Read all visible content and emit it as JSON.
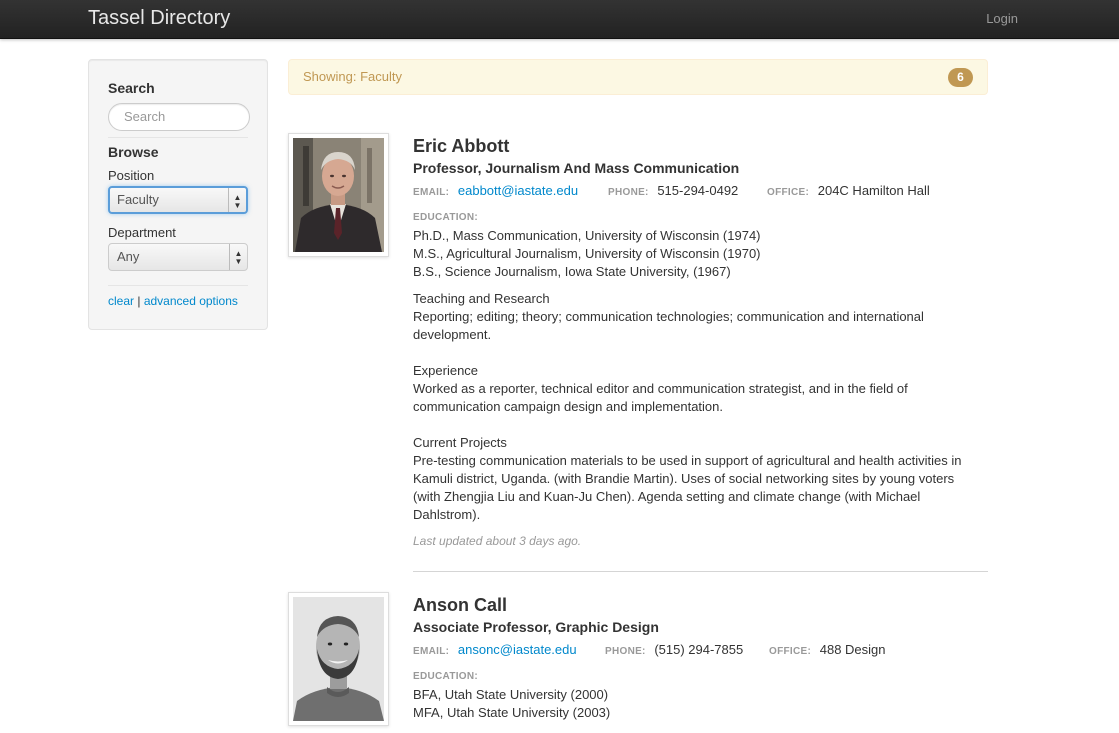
{
  "navbar": {
    "brand": "Tassel Directory",
    "login": "Login"
  },
  "sidebar": {
    "search_heading": "Search",
    "search_placeholder": "Search",
    "browse_heading": "Browse",
    "position_label": "Position",
    "position_value": "Faculty",
    "department_label": "Department",
    "department_value": "Any",
    "clear_link": "clear",
    "separator": "|",
    "advanced_link": "advanced options"
  },
  "filter": {
    "showing_text": "Showing: Faculty",
    "count": "6"
  },
  "people": [
    {
      "name": "Eric Abbott",
      "title": "Professor, Journalism And Mass Communication",
      "email_label": "EMAIL:",
      "email": "eabbott@iastate.edu",
      "phone_label": "PHONE:",
      "phone": "515-294-0492",
      "office_label": "OFFICE:",
      "office": "204C Hamilton Hall",
      "education_label": "EDUCATION:",
      "education": [
        "Ph.D., Mass Communication, University of Wisconsin (1974)",
        "M.S., Agricultural Journalism, University of Wisconsin (1970)",
        "B.S., Science Journalism, Iowa State University, (1967)"
      ],
      "sections": [
        {
          "heading": "Teaching and Research",
          "text": "Reporting; editing; theory; communication technologies; communication and international development."
        },
        {
          "heading": "Experience",
          "text": "Worked as a reporter, technical editor and communication strategist, and in the field of communication campaign design and implementation."
        },
        {
          "heading": "Current Projects",
          "text": "Pre-testing communication materials to be used in support of agricultural and health activities in Kamuli district, Uganda. (with Brandie Martin). Uses of social networking sites by young voters (with Zhengjia Liu and Kuan-Ju Chen). Agenda setting and climate change (with Michael Dahlstrom)."
        }
      ],
      "updated": "Last updated about 3 days ago."
    },
    {
      "name": "Anson Call",
      "title": "Associate Professor, Graphic Design",
      "email_label": "EMAIL:",
      "email": "ansonc@iastate.edu",
      "phone_label": "PHONE:",
      "phone": "(515) 294-7855",
      "office_label": "OFFICE:",
      "office": "488 Design",
      "education_label": "EDUCATION:",
      "education": [
        "BFA, Utah State University (2000)",
        "MFA, Utah State University (2003)"
      ]
    }
  ]
}
